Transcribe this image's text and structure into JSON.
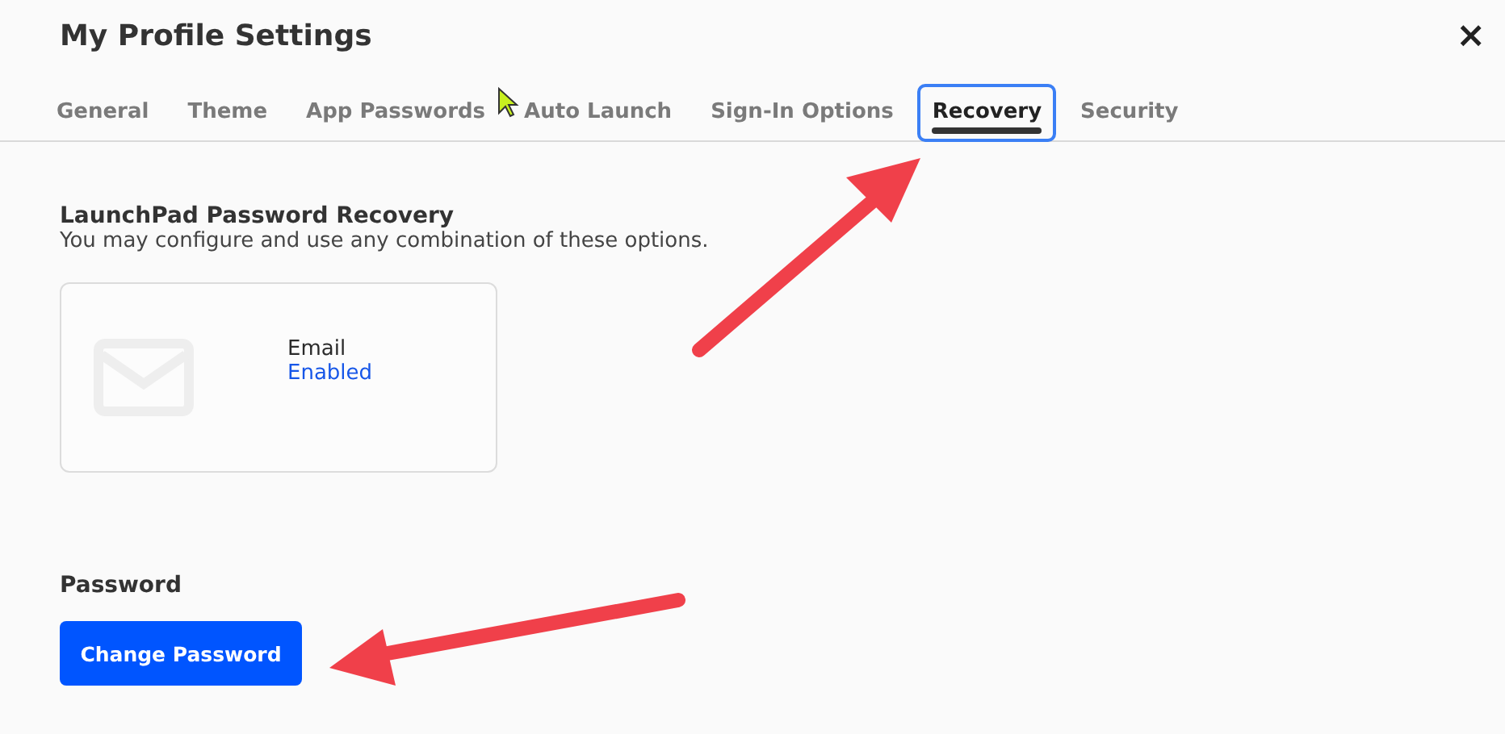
{
  "dialog": {
    "title": "My Profile Settings",
    "close": "×"
  },
  "tabs": [
    {
      "label": "General",
      "selected": false
    },
    {
      "label": "Theme",
      "selected": false
    },
    {
      "label": "App Passwords",
      "selected": false
    },
    {
      "label": "Auto Launch",
      "selected": false
    },
    {
      "label": "Sign-In Options",
      "selected": false
    },
    {
      "label": "Recovery",
      "selected": true
    },
    {
      "label": "Security",
      "selected": false
    }
  ],
  "recovery": {
    "heading": "LaunchPad Password Recovery",
    "description": "You may configure and use any combination of these options.",
    "options": [
      {
        "kind": "email",
        "label": "Email",
        "status": "Enabled"
      }
    ]
  },
  "password": {
    "heading": "Password",
    "button": "Change Password"
  }
}
